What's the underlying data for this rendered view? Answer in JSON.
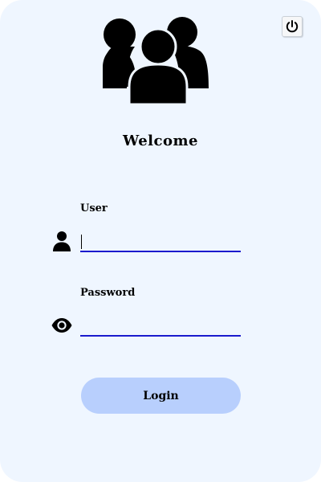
{
  "header": {
    "welcome": "Welcome"
  },
  "icons": {
    "group": "users-group-icon",
    "power": "power-icon",
    "user": "user-icon",
    "password": "eye-icon"
  },
  "form": {
    "user_label": "User",
    "user_value": "",
    "password_label": "Password",
    "password_value": "",
    "login_label": "Login"
  },
  "colors": {
    "panel_background": "#eff6ff",
    "input_underline": "#1a1acd",
    "login_button": "#b8cffd",
    "icon": "#000000"
  }
}
